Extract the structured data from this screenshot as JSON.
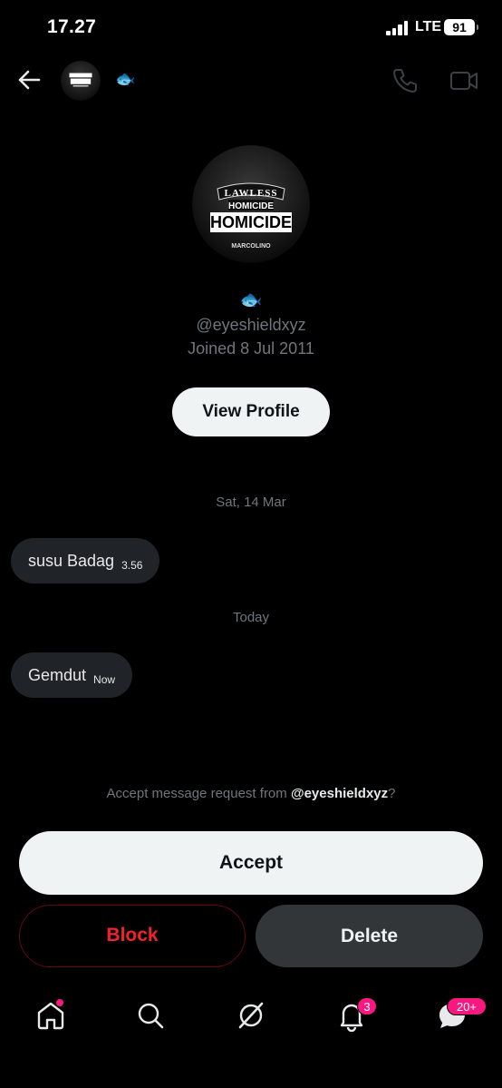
{
  "status_bar": {
    "time": "17.27",
    "network": "LTE",
    "battery": "91"
  },
  "header": {
    "emoji": "🐟",
    "back_icon": "arrow-left-icon",
    "call_icon": "phone-icon",
    "video_icon": "video-camera-icon"
  },
  "avatar_art": {
    "line1": "LAWLESS",
    "line2": "HOMICIDE",
    "line3": "HOMICIDE",
    "line4": "MARCOLINO"
  },
  "profile": {
    "emoji": "🐟",
    "handle": "@eyeshieldxyz",
    "joined": "Joined 8 Jul 2011",
    "view_profile_label": "View Profile"
  },
  "conversation": {
    "groups": [
      {
        "date": "Sat, 14 Mar",
        "message": "susu Badag",
        "time": "3.56"
      },
      {
        "date": "Today",
        "message": "Gemdut",
        "time": "Now"
      }
    ]
  },
  "request": {
    "prefix": "Accept message request from ",
    "handle": "@eyeshieldxyz",
    "suffix": "?",
    "accept_label": "Accept",
    "block_label": "Block",
    "delete_label": "Delete"
  },
  "nav": {
    "items": [
      {
        "icon": "home-icon",
        "has_dot": true
      },
      {
        "icon": "search-icon"
      },
      {
        "icon": "grok-icon"
      },
      {
        "icon": "bell-icon",
        "badge": "3"
      },
      {
        "icon": "messages-icon",
        "badge": "20+"
      }
    ]
  },
  "colors": {
    "background": "#000000",
    "muted_text": "#71767b",
    "bubble": "#202327",
    "block_red": "#f4212e",
    "badge_pink": "#f91880"
  }
}
